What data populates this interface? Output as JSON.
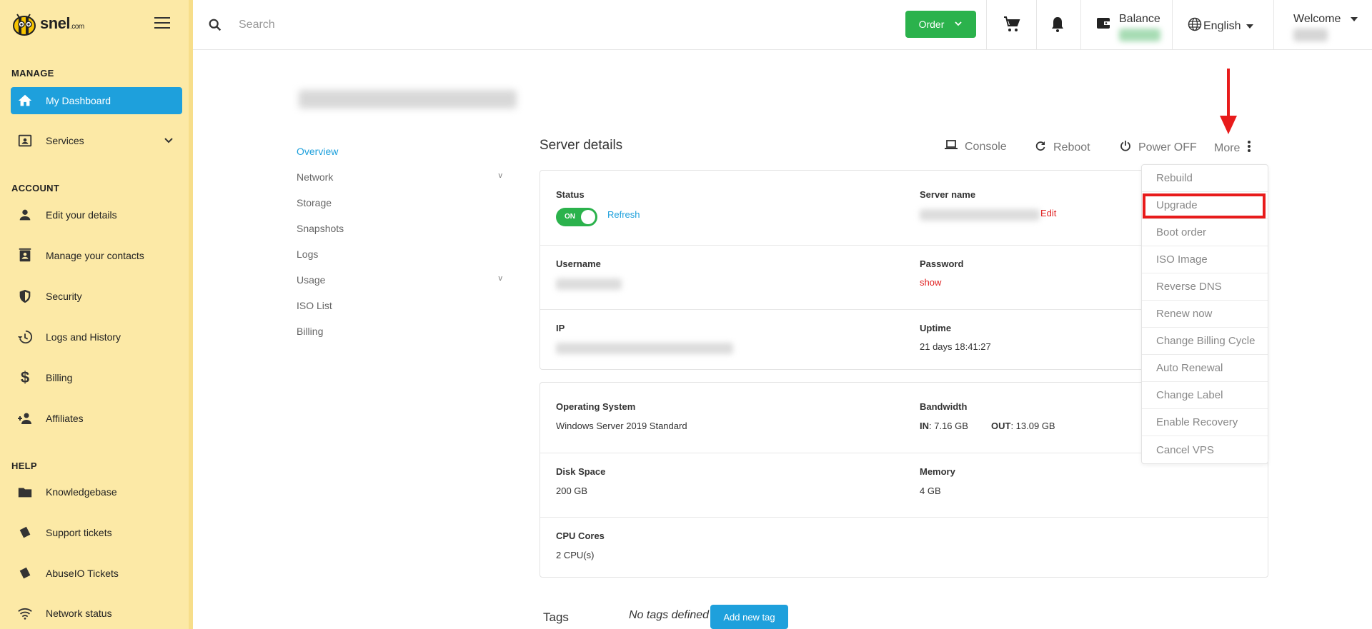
{
  "brand": {
    "name": "snel",
    "suffix": ".com"
  },
  "sidebar": {
    "sections": {
      "manage": "MANAGE",
      "account": "ACCOUNT",
      "help": "HELP"
    },
    "items": [
      {
        "label": "My Dashboard",
        "icon": "home-icon"
      },
      {
        "label": "Services",
        "icon": "services-icon"
      },
      {
        "label": "Edit your details",
        "icon": "person-icon"
      },
      {
        "label": "Manage your contacts",
        "icon": "contacts-icon"
      },
      {
        "label": "Security",
        "icon": "shield-icon"
      },
      {
        "label": "Logs and History",
        "icon": "history-icon"
      },
      {
        "label": "Billing",
        "icon": "dollar-icon"
      },
      {
        "label": "Affiliates",
        "icon": "affiliates-icon"
      },
      {
        "label": "Knowledgebase",
        "icon": "folder-icon"
      },
      {
        "label": "Support tickets",
        "icon": "tickets-icon"
      },
      {
        "label": "AbuseIO Tickets",
        "icon": "tickets-icon"
      },
      {
        "label": "Network status",
        "icon": "wifi-icon"
      }
    ]
  },
  "topbar": {
    "search_placeholder": "Search",
    "order_label": "Order",
    "balance_label": "Balance",
    "language": "English",
    "welcome_label": "Welcome"
  },
  "subnav": [
    {
      "label": "Overview"
    },
    {
      "label": "Network"
    },
    {
      "label": "Storage"
    },
    {
      "label": "Snapshots"
    },
    {
      "label": "Logs"
    },
    {
      "label": "Usage"
    },
    {
      "label": "ISO List"
    },
    {
      "label": "Billing"
    }
  ],
  "server": {
    "title": "Server details",
    "actions": {
      "console": "Console",
      "reboot": "Reboot",
      "power": "Power OFF",
      "more": "More"
    },
    "status_label": "Status",
    "toggle_text": "ON",
    "refresh": "Refresh",
    "server_name_label": "Server name",
    "edit": "Edit",
    "username_label": "Username",
    "password_label": "Password",
    "show": "show",
    "ip_label": "IP",
    "uptime_label": "Uptime",
    "uptime_value": "21 days 18:41:27",
    "os_label": "Operating System",
    "os_value": "Windows Server 2019 Standard",
    "bandwidth_label": "Bandwidth",
    "bw_in_label": "IN",
    "bw_in_value": ": 7.16 GB",
    "bw_out_label": "OUT",
    "bw_out_value": ": 13.09 GB",
    "disk_label": "Disk Space",
    "disk_value": "200 GB",
    "memory_label": "Memory",
    "memory_value": "4 GB",
    "cpu_label": "CPU Cores",
    "cpu_value": "2 CPU(s)"
  },
  "more_menu": [
    "Rebuild",
    "Upgrade",
    "Boot order",
    "ISO Image",
    "Reverse DNS",
    "Renew now",
    "Change Billing Cycle",
    "Auto Renewal",
    "Change Label",
    "Enable Recovery",
    "Cancel VPS"
  ],
  "tags": {
    "label": "Tags",
    "empty": "No tags defined",
    "add": "Add new tag"
  },
  "colors": {
    "sidebar_bg": "#fce9a6",
    "accent_blue": "#1ea0dc",
    "order_green": "#2bb24c",
    "highlight_red": "#e81b1b"
  }
}
